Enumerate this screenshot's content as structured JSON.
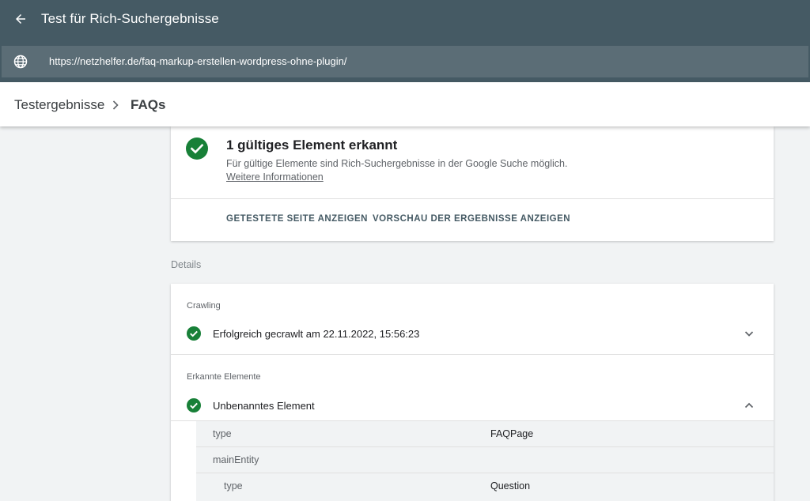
{
  "header": {
    "title": "Test für Rich-Suchergebnisse",
    "url": "https://netzhelfer.de/faq-markup-erstellen-wordpress-ohne-plugin/"
  },
  "breadcrumb": {
    "root": "Testergebnisse",
    "current": "FAQs"
  },
  "summary": {
    "title": "1 gültiges Element erkannt",
    "description": "Für gültige Elemente sind Rich-Suchergebnisse in der Google Suche möglich.",
    "link": "Weitere Informationen",
    "actions": [
      "GETESTETE SEITE ANZEIGEN",
      "VORSCHAU DER ERGEBNISSE ANZEIGEN"
    ]
  },
  "details": {
    "label": "Details",
    "crawling": {
      "label": "Crawling",
      "status": "Erfolgreich gecrawlt am 22.11.2022, 15:56:23"
    },
    "detected": {
      "label": "Erkannte Elemente",
      "item": "Unbenanntes Element",
      "properties": [
        {
          "key": "type",
          "value": "FAQPage"
        },
        {
          "key": "mainEntity",
          "value": ""
        },
        {
          "key": "type",
          "value": "Question"
        }
      ]
    }
  },
  "colors": {
    "header": "#455a64",
    "urlbar": "#5b6d76",
    "success": "#188038",
    "accent_text": "#455a64"
  },
  "icons": {
    "back": "arrow-left-icon",
    "globe": "globe-icon",
    "breadcrumb_sep": "chevron-right-icon",
    "check": "check-circle-icon",
    "expand": "chevron-down-icon",
    "collapse": "chevron-up-icon"
  }
}
